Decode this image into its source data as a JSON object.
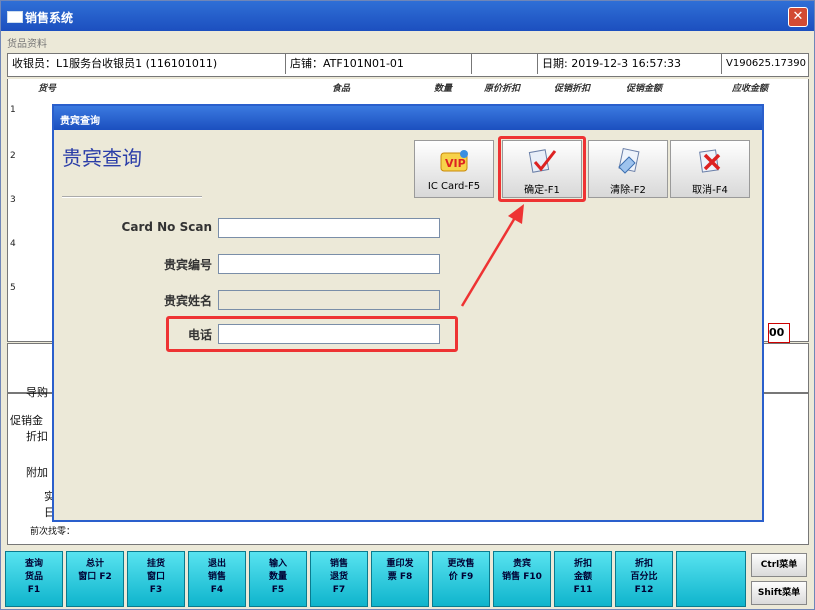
{
  "window": {
    "title": "销售系统"
  },
  "menubar": {
    "label": "货品资料"
  },
  "info": {
    "cashier": "收银员：L1服务台收银员1 (116101011)",
    "store": "店铺：ATF101N01-01",
    "date_label": "日期: 2019-12-3     16:57:33",
    "version": "V190625.17390"
  },
  "columns": [
    "货号",
    "食品",
    "数量",
    "原价折扣",
    "促销折扣",
    "促销金额",
    "应收金额"
  ],
  "grid_rows": [
    "1",
    "2",
    "3",
    "4",
    "5"
  ],
  "amount_suffix": "00",
  "low_labels": [
    "导购",
    "促销金",
    "折扣",
    "附加",
    "实",
    "日",
    "前次找零："
  ],
  "dialog": {
    "title": "贵宾查询",
    "heading": "贵宾查询",
    "buttons": [
      {
        "label": "IC Card-F5",
        "icon": "vip-icon"
      },
      {
        "label": "确定-F1",
        "icon": "checkmark-icon"
      },
      {
        "label": "清除-F2",
        "icon": "eraser-icon"
      },
      {
        "label": "取消-F4",
        "icon": "cancel-icon"
      }
    ],
    "fields": [
      {
        "label": "Card No Scan",
        "value": ""
      },
      {
        "label": "贵宾编号",
        "value": ""
      },
      {
        "label": "贵宾姓名",
        "value": ""
      },
      {
        "label": "电话",
        "value": ""
      }
    ]
  },
  "fkeys": [
    {
      "l1": "查询",
      "l2": "货品",
      "l3": "F1"
    },
    {
      "l1": "总计",
      "l2": "窗口 F2",
      "l3": ""
    },
    {
      "l1": "挂货",
      "l2": "窗口",
      "l3": "F3"
    },
    {
      "l1": "退出",
      "l2": "销售",
      "l3": "F4"
    },
    {
      "l1": "输入",
      "l2": "数量",
      "l3": "F5"
    },
    {
      "l1": "销售",
      "l2": "退货",
      "l3": "F7"
    },
    {
      "l1": "重印发",
      "l2": "票 F8",
      "l3": ""
    },
    {
      "l1": "更改售",
      "l2": "价 F9",
      "l3": ""
    },
    {
      "l1": "贵宾",
      "l2": "销售 F10",
      "l3": ""
    },
    {
      "l1": "折扣",
      "l2": "金额",
      "l3": "F11"
    },
    {
      "l1": "折扣",
      "l2": "百分比",
      "l3": "F12"
    }
  ],
  "ctrl_buttons": {
    "ctrl": "Ctrl菜单",
    "shift": "Shift菜单"
  },
  "colors": {
    "highlight": "#ee3333",
    "fkey": "#17bcd2",
    "title": "#1c4fbf"
  }
}
